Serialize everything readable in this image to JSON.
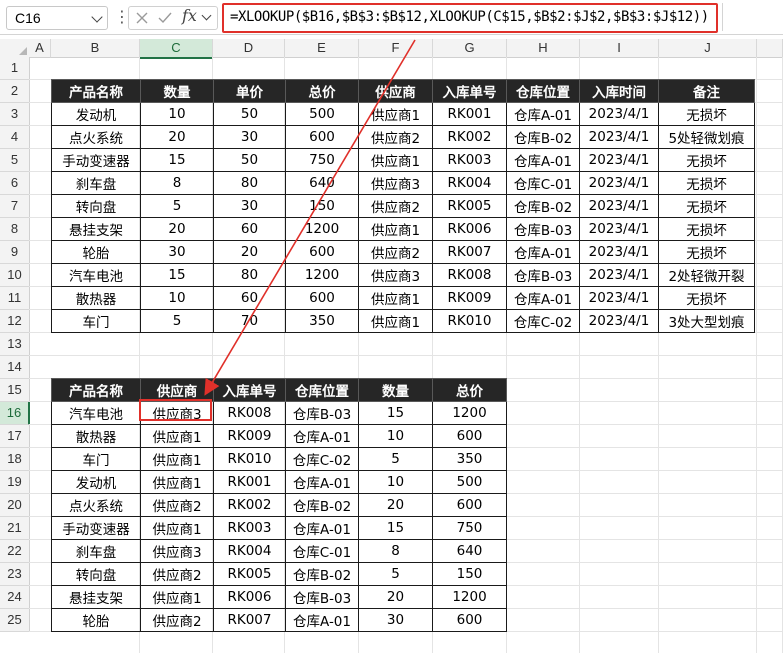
{
  "formula_bar": {
    "name_box": "C16",
    "separator": "⋮",
    "fx_label": "fx",
    "formula": "=XLOOKUP($B16,$B$3:$B$12,XLOOKUP(C$15,$B$2:$J$2,$B$3:$J$12))"
  },
  "columns": [
    "A",
    "B",
    "C",
    "D",
    "E",
    "F",
    "G",
    "H",
    "I",
    "J"
  ],
  "rows": [
    "1",
    "2",
    "3",
    "4",
    "5",
    "6",
    "7",
    "8",
    "9",
    "10",
    "11",
    "12",
    "13",
    "14",
    "15",
    "16",
    "17",
    "18",
    "19",
    "20",
    "21",
    "22",
    "23",
    "24",
    "25"
  ],
  "selected_cell": {
    "column": "C",
    "row": "16"
  },
  "table1": {
    "headers": [
      "产品名称",
      "数量",
      "单价",
      "总价",
      "供应商",
      "入库单号",
      "仓库位置",
      "入库时间",
      "备注"
    ],
    "rows": [
      [
        "发动机",
        "10",
        "50",
        "500",
        "供应商1",
        "RK001",
        "仓库A-01",
        "2023/4/1",
        "无损坏"
      ],
      [
        "点火系统",
        "20",
        "30",
        "600",
        "供应商2",
        "RK002",
        "仓库B-02",
        "2023/4/1",
        "5处轻微划痕"
      ],
      [
        "手动变速器",
        "15",
        "50",
        "750",
        "供应商1",
        "RK003",
        "仓库A-01",
        "2023/4/1",
        "无损坏"
      ],
      [
        "刹车盘",
        "8",
        "80",
        "640",
        "供应商3",
        "RK004",
        "仓库C-01",
        "2023/4/1",
        "无损坏"
      ],
      [
        "转向盘",
        "5",
        "30",
        "150",
        "供应商2",
        "RK005",
        "仓库B-02",
        "2023/4/1",
        "无损坏"
      ],
      [
        "悬挂支架",
        "20",
        "60",
        "1200",
        "供应商1",
        "RK006",
        "仓库B-03",
        "2023/4/1",
        "无损坏"
      ],
      [
        "轮胎",
        "30",
        "20",
        "600",
        "供应商2",
        "RK007",
        "仓库A-01",
        "2023/4/1",
        "无损坏"
      ],
      [
        "汽车电池",
        "15",
        "80",
        "1200",
        "供应商3",
        "RK008",
        "仓库B-03",
        "2023/4/1",
        "2处轻微开裂"
      ],
      [
        "散热器",
        "10",
        "60",
        "600",
        "供应商1",
        "RK009",
        "仓库A-01",
        "2023/4/1",
        "无损坏"
      ],
      [
        "车门",
        "5",
        "70",
        "350",
        "供应商1",
        "RK010",
        "仓库C-02",
        "2023/4/1",
        "3处大型划痕"
      ]
    ]
  },
  "table2": {
    "headers": [
      "产品名称",
      "供应商",
      "入库单号",
      "仓库位置",
      "数量",
      "总价"
    ],
    "rows": [
      [
        "汽车电池",
        "供应商3",
        "RK008",
        "仓库B-03",
        "15",
        "1200"
      ],
      [
        "散热器",
        "供应商1",
        "RK009",
        "仓库A-01",
        "10",
        "600"
      ],
      [
        "车门",
        "供应商1",
        "RK010",
        "仓库C-02",
        "5",
        "350"
      ],
      [
        "发动机",
        "供应商1",
        "RK001",
        "仓库A-01",
        "10",
        "500"
      ],
      [
        "点火系统",
        "供应商2",
        "RK002",
        "仓库B-02",
        "20",
        "600"
      ],
      [
        "手动变速器",
        "供应商1",
        "RK003",
        "仓库A-01",
        "15",
        "750"
      ],
      [
        "刹车盘",
        "供应商3",
        "RK004",
        "仓库C-01",
        "8",
        "640"
      ],
      [
        "转向盘",
        "供应商2",
        "RK005",
        "仓库B-02",
        "5",
        "150"
      ],
      [
        "悬挂支架",
        "供应商1",
        "RK006",
        "仓库B-03",
        "20",
        "1200"
      ],
      [
        "轮胎",
        "供应商2",
        "RK007",
        "仓库A-01",
        "30",
        "600"
      ]
    ]
  },
  "colors": {
    "highlight": "#e0302a",
    "header_fill": "#262626",
    "selection_green": "#217346"
  }
}
